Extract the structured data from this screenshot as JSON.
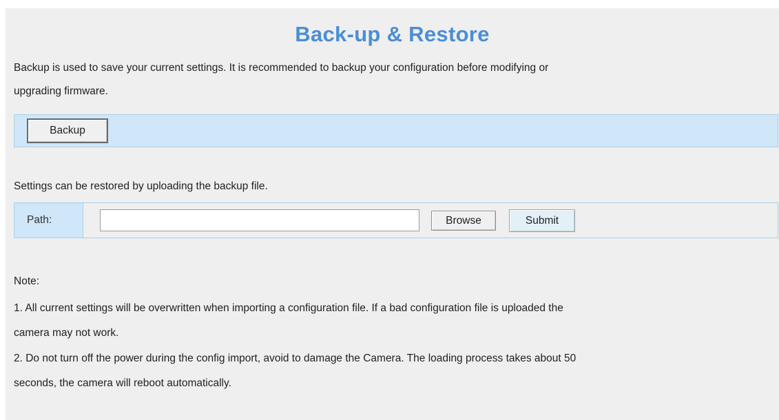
{
  "page": {
    "title": "Back-up & Restore"
  },
  "backup": {
    "description_line1": "Backup is used to save your current settings. It is recommended to backup your configuration before modifying or",
    "description_line2": "upgrading firmware.",
    "button_label": "Backup"
  },
  "restore": {
    "description": "Settings can be restored by uploading the backup file.",
    "path_label": "Path:",
    "path_value": "",
    "browse_label": "Browse",
    "submit_label": "Submit"
  },
  "notes": {
    "heading": "Note:",
    "items": [
      {
        "line1": "1. All current settings will be overwritten when importing a configuration file. If a bad configuration file is uploaded the",
        "line2": "camera may not work."
      },
      {
        "line1": "2. Do not turn off the power during the config import, avoid to damage the Camera. The loading process takes about 50",
        "line2": "seconds, the camera will reboot automatically."
      }
    ]
  },
  "colors": {
    "title": "#4a8ed6",
    "panel_bg": "#efefef",
    "bar_bg": "#cfe7f8",
    "bar_border": "#a9cfea"
  }
}
